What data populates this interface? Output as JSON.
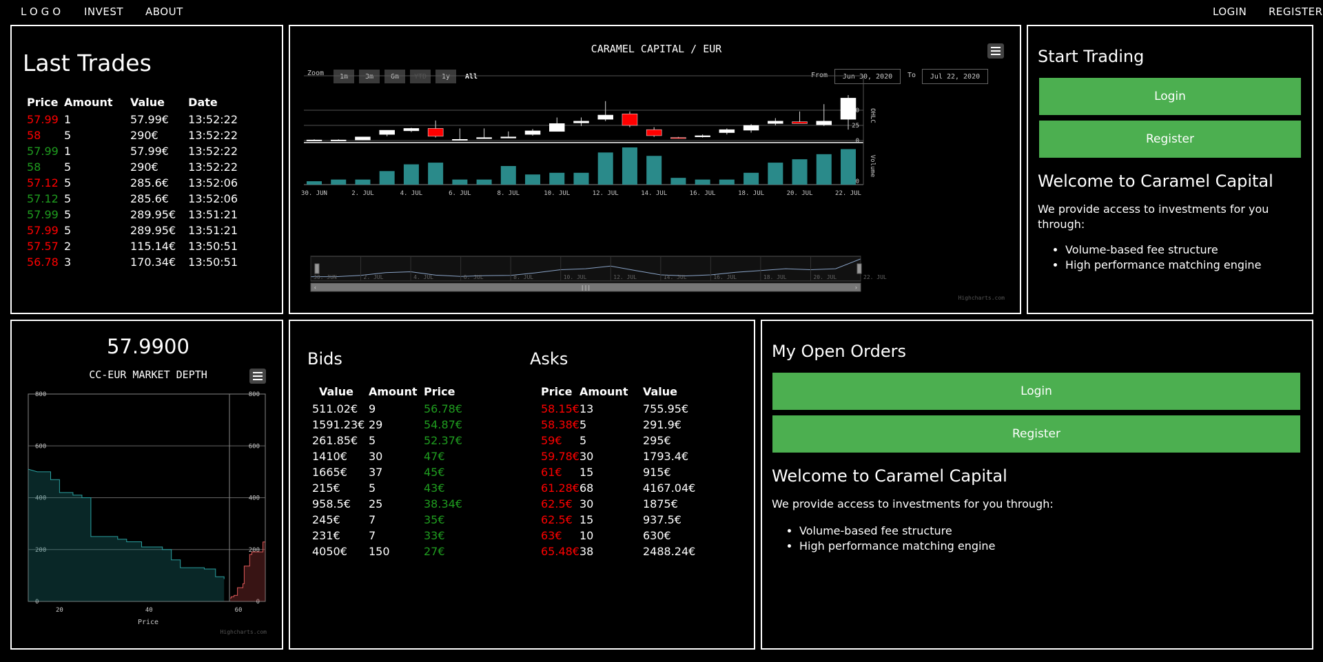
{
  "nav": {
    "logo": "LOGO",
    "invest": "INVEST",
    "about": "ABOUT",
    "login": "LOGIN",
    "register": "REGISTER"
  },
  "last_trades": {
    "title": "Last Trades",
    "headers": [
      "Price",
      "Amount",
      "Value",
      "Date"
    ],
    "rows": [
      {
        "price": "57.99",
        "amount": "1",
        "value": "57.99€",
        "date": "13:52:22",
        "side": "sell"
      },
      {
        "price": "58",
        "amount": "5",
        "value": "290€",
        "date": "13:52:22",
        "side": "sell"
      },
      {
        "price": "57.99",
        "amount": "1",
        "value": "57.99€",
        "date": "13:52:22",
        "side": "buy"
      },
      {
        "price": "58",
        "amount": "5",
        "value": "290€",
        "date": "13:52:22",
        "side": "buy"
      },
      {
        "price": "57.12",
        "amount": "5",
        "value": "285.6€",
        "date": "13:52:06",
        "side": "sell"
      },
      {
        "price": "57.12",
        "amount": "5",
        "value": "285.6€",
        "date": "13:52:06",
        "side": "buy"
      },
      {
        "price": "57.99",
        "amount": "5",
        "value": "289.95€",
        "date": "13:51:21",
        "side": "buy"
      },
      {
        "price": "57.99",
        "amount": "5",
        "value": "289.95€",
        "date": "13:51:21",
        "side": "sell"
      },
      {
        "price": "57.57",
        "amount": "2",
        "value": "115.14€",
        "date": "13:50:51",
        "side": "sell"
      },
      {
        "price": "56.78",
        "amount": "3",
        "value": "170.34€",
        "date": "13:50:51",
        "side": "sell"
      }
    ]
  },
  "price_chart": {
    "title": "CARAMEL CAPITAL / EUR",
    "zoom_label": "Zoom",
    "zoom_options": [
      "1m",
      "3m",
      "6m",
      "YTD",
      "1y",
      "All"
    ],
    "from_label": "From",
    "from_value": "Jun 30, 2020",
    "to_label": "To",
    "to_value": "Jul 22, 2020",
    "credit": "Highcharts.com"
  },
  "start_trading": {
    "title": "Start Trading",
    "login": "Login",
    "register": "Register",
    "welcome": "Welcome to Caramel Capital",
    "text": "We provide access to investments for you through:",
    "features": [
      "Volume-based fee structure",
      "High performance matching engine"
    ]
  },
  "depth": {
    "last_price": "57.9900",
    "title": "CC-EUR MARKET DEPTH",
    "xlabel": "Price",
    "credit": "Highcharts.com"
  },
  "orderbook": {
    "bids_title": "Bids",
    "asks_title": "Asks",
    "bids_headers": [
      "Value",
      "Amount",
      "Price"
    ],
    "asks_headers": [
      "Price",
      "Amount",
      "Value"
    ],
    "bids": [
      {
        "value": "511.02€",
        "amount": "9",
        "price": "56.78€"
      },
      {
        "value": "1591.23€",
        "amount": "29",
        "price": "54.87€"
      },
      {
        "value": "261.85€",
        "amount": "5",
        "price": "52.37€"
      },
      {
        "value": "1410€",
        "amount": "30",
        "price": "47€"
      },
      {
        "value": "1665€",
        "amount": "37",
        "price": "45€"
      },
      {
        "value": "215€",
        "amount": "5",
        "price": "43€"
      },
      {
        "value": "958.5€",
        "amount": "25",
        "price": "38.34€"
      },
      {
        "value": "245€",
        "amount": "7",
        "price": "35€"
      },
      {
        "value": "231€",
        "amount": "7",
        "price": "33€"
      },
      {
        "value": "4050€",
        "amount": "150",
        "price": "27€"
      }
    ],
    "asks": [
      {
        "price": "58.15€",
        "amount": "13",
        "value": "755.95€"
      },
      {
        "price": "58.38€",
        "amount": "5",
        "value": "291.9€"
      },
      {
        "price": "59€",
        "amount": "5",
        "value": "295€"
      },
      {
        "price": "59.78€",
        "amount": "30",
        "value": "1793.4€"
      },
      {
        "price": "61€",
        "amount": "15",
        "value": "915€"
      },
      {
        "price": "61.28€",
        "amount": "68",
        "value": "4167.04€"
      },
      {
        "price": "62.5€",
        "amount": "30",
        "value": "1875€"
      },
      {
        "price": "62.5€",
        "amount": "15",
        "value": "937.5€"
      },
      {
        "price": "63€",
        "amount": "10",
        "value": "630€"
      },
      {
        "price": "65.48€",
        "amount": "38",
        "value": "2488.24€"
      }
    ]
  },
  "open_orders": {
    "title": "My Open Orders",
    "login": "Login",
    "register": "Register",
    "welcome": "Welcome to Caramel Capital",
    "text": "We provide access to investments for you through:",
    "features": [
      "Volume-based fee structure",
      "High performance matching engine"
    ]
  },
  "colors": {
    "up": "#ffffff",
    "down": "#ff0000",
    "volume": "#2a8a8a",
    "bid": "#1a6f6f",
    "ask": "#a03a3a",
    "button": "#4caf50"
  },
  "chart_data": [
    {
      "type": "candlestick",
      "title": "CARAMEL CAPITAL / EUR",
      "x": [
        "30. Jun",
        "1. Jul",
        "2. Jul",
        "3. Jul",
        "4. Jul",
        "5. Jul",
        "6. Jul",
        "7. Jul",
        "8. Jul",
        "9. Jul",
        "10. Jul",
        "11. Jul",
        "12. Jul",
        "13. Jul",
        "14. Jul",
        "15. Jul",
        "16. Jul",
        "17. Jul",
        "18. Jul",
        "19. Jul",
        "20. Jul",
        "21. Jul",
        "22. Jul"
      ],
      "x_tick_labels": [
        "30. Jun",
        "2. Jul",
        "4. Jul",
        "6. Jul",
        "8. Jul",
        "10. Jul",
        "12. Jul",
        "14. Jul",
        "16. Jul",
        "18. Jul",
        "20. Jul",
        "22. Jul"
      ],
      "ohlc": [
        [
          1,
          2,
          0,
          1
        ],
        [
          1,
          2,
          1,
          1
        ],
        [
          1,
          6,
          1,
          6
        ],
        [
          10,
          15,
          7,
          17
        ],
        [
          16,
          21,
          14,
          20
        ],
        [
          20,
          33,
          5,
          7
        ],
        [
          2,
          20,
          2,
          2
        ],
        [
          3,
          20,
          3,
          5
        ],
        [
          4,
          15,
          4,
          6
        ],
        [
          10,
          19,
          8,
          16
        ],
        [
          15,
          38,
          15,
          28
        ],
        [
          29,
          38,
          24,
          32
        ],
        [
          35,
          65,
          32,
          42
        ],
        [
          44,
          48,
          22,
          25
        ],
        [
          18,
          22,
          6,
          8
        ],
        [
          5,
          6,
          3,
          4
        ],
        [
          6,
          10,
          5,
          8
        ],
        [
          13,
          20,
          10,
          18
        ],
        [
          17,
          27,
          13,
          25
        ],
        [
          28,
          37,
          25,
          32
        ],
        [
          31,
          48,
          30,
          28
        ],
        [
          26,
          60,
          24,
          32
        ],
        [
          35,
          75,
          18,
          70
        ]
      ],
      "volume": [
        2,
        3,
        3,
        8,
        12,
        13,
        3,
        3,
        11,
        6,
        7,
        7,
        19,
        22,
        17,
        4,
        3,
        3,
        7,
        13,
        15,
        18,
        21
      ],
      "y_axis_label": "OHLC",
      "y_ticks": [
        0,
        25,
        50
      ],
      "volume_axis_label": "Volume",
      "volume_ticks": [
        0
      ]
    },
    {
      "type": "area",
      "title": "CC-EUR MARKET DEPTH",
      "xlabel": "Price",
      "x_ticks": [
        20,
        40,
        60
      ],
      "y_ticks": [
        0,
        200,
        400,
        600,
        800
      ],
      "ylim": [
        0,
        800
      ],
      "xlim": [
        13,
        66
      ],
      "series": [
        {
          "name": "Bids",
          "points": [
            [
              13,
              510
            ],
            [
              15,
              500
            ],
            [
              18,
              500
            ],
            [
              18,
              470
            ],
            [
              20,
              470
            ],
            [
              20,
              420
            ],
            [
              23,
              420
            ],
            [
              23,
              410
            ],
            [
              25,
              410
            ],
            [
              25,
              400
            ],
            [
              27,
              400
            ],
            [
              27,
              250
            ],
            [
              33,
              250
            ],
            [
              33,
              240
            ],
            [
              35,
              240
            ],
            [
              35,
              230
            ],
            [
              38.34,
              230
            ],
            [
              38.34,
              210
            ],
            [
              43,
              210
            ],
            [
              43,
              200
            ],
            [
              45,
              200
            ],
            [
              45,
              160
            ],
            [
              47,
              160
            ],
            [
              47,
              130
            ],
            [
              52.37,
              130
            ],
            [
              52.37,
              125
            ],
            [
              54.87,
              125
            ],
            [
              54.87,
              95
            ],
            [
              56.78,
              95
            ],
            [
              56.78,
              86
            ]
          ]
        },
        {
          "name": "Asks",
          "points": [
            [
              58.15,
              13
            ],
            [
              58.38,
              13
            ],
            [
              58.38,
              18
            ],
            [
              59,
              18
            ],
            [
              59,
              23
            ],
            [
              59.78,
              23
            ],
            [
              59.78,
              53
            ],
            [
              61,
              53
            ],
            [
              61,
              68
            ],
            [
              61.28,
              68
            ],
            [
              61.28,
              136
            ],
            [
              62.5,
              136
            ],
            [
              62.5,
              181
            ],
            [
              63,
              181
            ],
            [
              63,
              191
            ],
            [
              65.48,
              191
            ],
            [
              65.48,
              229
            ],
            [
              66,
              229
            ]
          ]
        }
      ]
    }
  ]
}
